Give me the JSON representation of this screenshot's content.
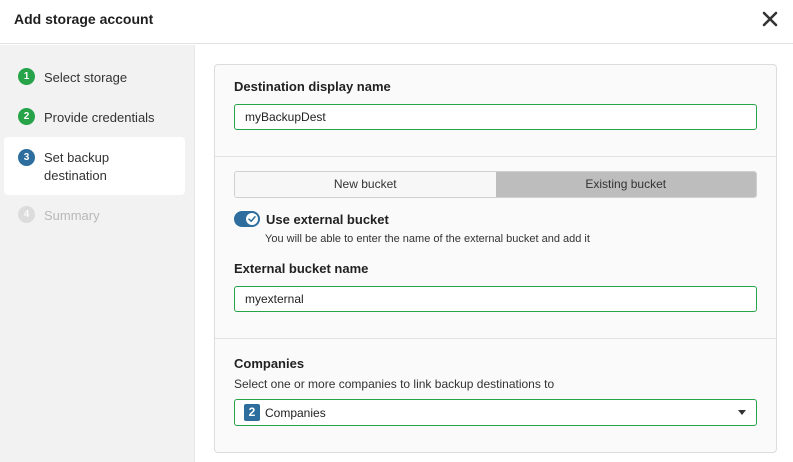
{
  "dialog": {
    "title": "Add storage account",
    "close_icon": "close-icon"
  },
  "steps": [
    {
      "number": "1",
      "label": "Select storage",
      "state": "done"
    },
    {
      "number": "2",
      "label": "Provide credentials",
      "state": "done"
    },
    {
      "number": "3",
      "label": "Set backup destination",
      "label_line1": "Set backup",
      "label_line2": "destination",
      "state": "current"
    },
    {
      "number": "4",
      "label": "Summary",
      "state": "pending"
    }
  ],
  "form": {
    "display_name_label": "Destination display name",
    "display_name_value": "myBackupDest",
    "bucket_tabs": [
      "New bucket",
      "Existing bucket"
    ],
    "bucket_tab_selected": "Existing bucket",
    "external_toggle_label": "Use external bucket",
    "external_toggle_on": true,
    "external_toggle_help": "You will be able to enter the name of the external bucket and add it",
    "external_bucket_label": "External bucket name",
    "external_bucket_value": "myexternal",
    "companies_label": "Companies",
    "companies_help": "Select one or more companies to link backup destinations to",
    "companies_count": "2",
    "companies_value": "Companies"
  },
  "colors": {
    "done_green": "#27a34a",
    "accent_blue": "#2d6e9e",
    "input_border_green": "#27a34a",
    "selected_tab_gray": "#bdbdbd"
  }
}
